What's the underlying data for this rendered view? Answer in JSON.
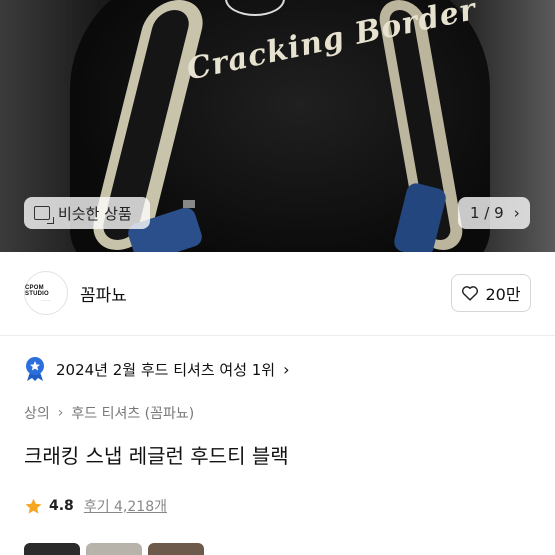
{
  "hero": {
    "print_text": "Cracking Border",
    "similar_label": "비슷한 상품",
    "pager_text": "1 / 9"
  },
  "seller": {
    "avatar_text": "CPOM STUDIO",
    "name": "꼼파뇨",
    "like_count": "20만"
  },
  "ranking": {
    "text": "2024년 2월 후드 티셔츠 여성 1위"
  },
  "breadcrumb": {
    "category": "상의",
    "subcategory": "후드 티셔츠 (꼼파뇨)"
  },
  "product": {
    "title": "크래킹 스냅 레글런 후드티 블랙"
  },
  "rating": {
    "score": "4.8",
    "reviews": "후기 4,218개"
  },
  "colors": {
    "star": "#f6a623",
    "medal": "#2a6fdb",
    "heart_stroke": "#222222"
  }
}
